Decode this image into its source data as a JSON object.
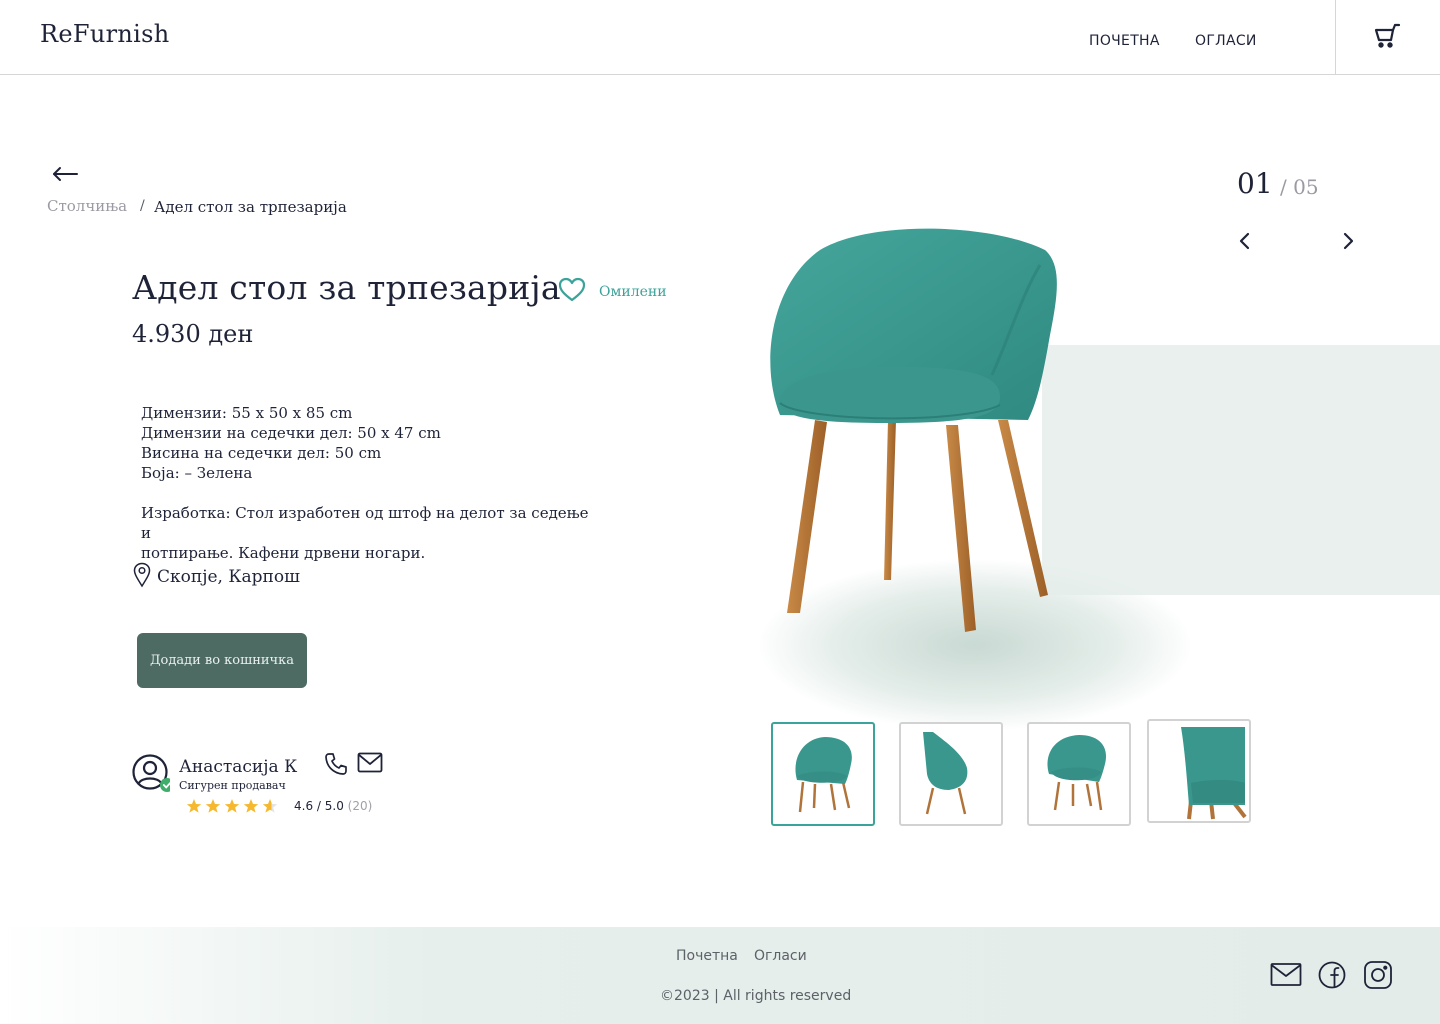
{
  "header": {
    "logo": "ReFurnish",
    "nav": {
      "home": "ПОЧЕТНА",
      "ads": "ОГЛАСИ"
    }
  },
  "breadcrumb": {
    "parent": "Столчиња",
    "separator": "/",
    "current": "Адел стол за трпезарија"
  },
  "product": {
    "title": "Адел стол за трпезарија",
    "favorite_label": "Омилени",
    "price": "4.930 ден",
    "specs": [
      "Димензии: 55 x 50 x 85 cm",
      "Димензии на седечки дел: 50 x 47 cm",
      "Висина на седечки дел: 50 cm",
      "Боја: – Зелена"
    ],
    "description_line1": "Изработка: Стол изработен од штоф на делот за седење и",
    "description_line2": "потпирање. Кафени дрвени ногари.",
    "location": "Скопје, Карпош",
    "add_to_cart": "Додади во кошничка"
  },
  "seller": {
    "name": "Анастасија К",
    "badge": "Сигурен продавач",
    "rating": "4.6 / 5.0",
    "rating_count": "(20)",
    "rating_value": 4.6
  },
  "gallery": {
    "current": "01",
    "total": "/ 05",
    "thumbnails": [
      "chair-front",
      "chair-side",
      "chair-front-small",
      "chair-closeup"
    ],
    "active_index": 0
  },
  "footer": {
    "links": {
      "home": "Почетна",
      "ads": "Огласи"
    },
    "copyright": "©2023 | All rights reserved"
  },
  "colors": {
    "accent": "#3aa39a",
    "button": "#4e6b63",
    "chair_fabric": "#3f9a91",
    "chair_wood": "#b8773a",
    "star": "#f5b82e"
  }
}
